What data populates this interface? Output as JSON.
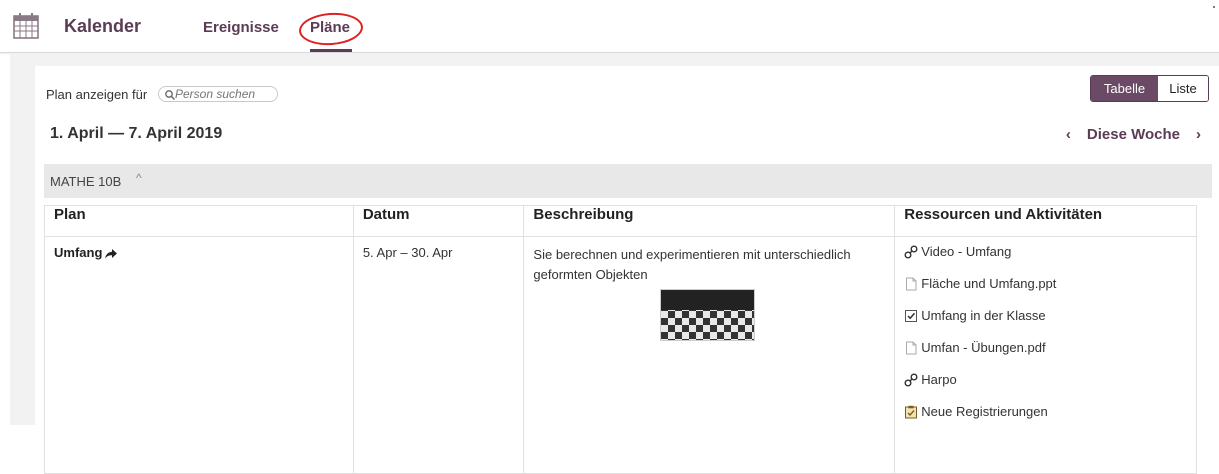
{
  "header": {
    "app_title": "Kalender",
    "tabs": [
      {
        "label": "Ereignisse"
      },
      {
        "label": "Pläne"
      }
    ],
    "accent_color": "#5b3c55",
    "annotation_color": "#e02020"
  },
  "toolbar": {
    "show_plan_for": "Plan anzeigen für",
    "person_search_placeholder": "Person suchen",
    "view_toggle": {
      "table": "Tabelle",
      "list": "Liste",
      "selected": "Tabelle"
    }
  },
  "week": {
    "range": "1. April — 7. April 2019",
    "prev": "‹",
    "label": "Diese Woche",
    "next": "›"
  },
  "group": {
    "name": "MATHE 10B",
    "caret": "^"
  },
  "table": {
    "headers": [
      "Plan",
      "Datum",
      "Beschreibung",
      "Ressourcen und Aktivitäten"
    ],
    "rows": [
      {
        "plan": "Umfang",
        "date": "5. Apr – 30. Apr",
        "description": "Sie berechnen und experimentieren mit unterschiedlich geformten Objekten",
        "resources": [
          {
            "icon": "link-icon",
            "label": "Video - Umfang"
          },
          {
            "icon": "file-icon",
            "label": "Fläche und Umfang.ppt"
          },
          {
            "icon": "checkbox-icon",
            "label": "Umfang in der Klasse"
          },
          {
            "icon": "file-icon",
            "label": "Umfan - Übungen.pdf"
          },
          {
            "icon": "link-icon",
            "label": "Harpo"
          },
          {
            "icon": "registration-icon",
            "label": "Neue Registrierungen"
          }
        ]
      }
    ]
  }
}
